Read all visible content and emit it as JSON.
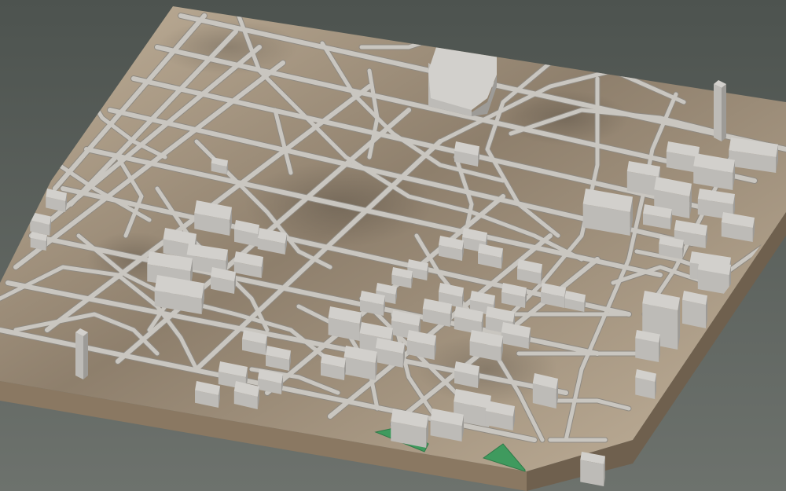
{
  "scene": {
    "kind": "3d-printed-city-terrain-model",
    "colors": {
      "background_top": "#4d534f",
      "background_bottom": "#6d726d",
      "terrain_light": "#c2b29b",
      "terrain_dark": "#8e7f6c",
      "terrain_side": "#8a7862",
      "terrain_side_dark": "#6f604e",
      "road": "#c9c6c0",
      "road_edge": "#8f8a82",
      "building_top": "#d2d0cc",
      "building_left": "#bdbbb7",
      "building_right": "#9d9b97",
      "park": "#3f9a5e",
      "park_dark": "#2f7a48"
    },
    "features": {
      "landmark": "stadium",
      "tall_towers": 2,
      "parks": 2
    }
  }
}
